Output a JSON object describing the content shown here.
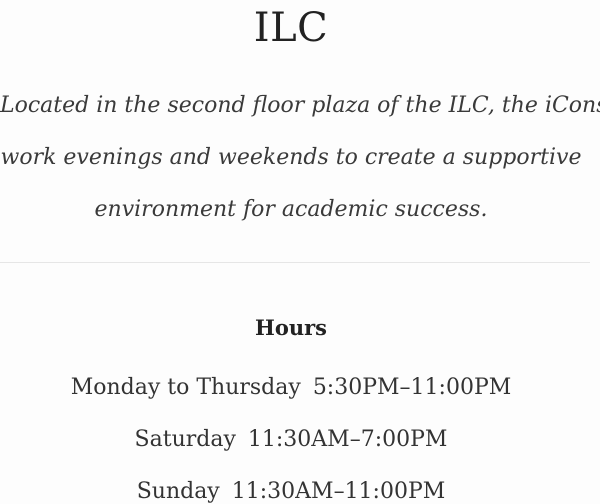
{
  "location": {
    "title": "ILC",
    "description_lines": [
      "Located in the second floor plaza of the ILC, the iCons",
      "work evenings and weekends to create a supportive",
      "environment for academic success."
    ]
  },
  "hours": {
    "heading": "Hours",
    "rows": [
      {
        "day": "Monday to Thursday",
        "time": "5:30PM–11:00PM"
      },
      {
        "day": "Saturday",
        "time": "11:30AM–7:00PM"
      },
      {
        "day": "Sunday",
        "time": "11:30AM–11:00PM"
      }
    ]
  }
}
